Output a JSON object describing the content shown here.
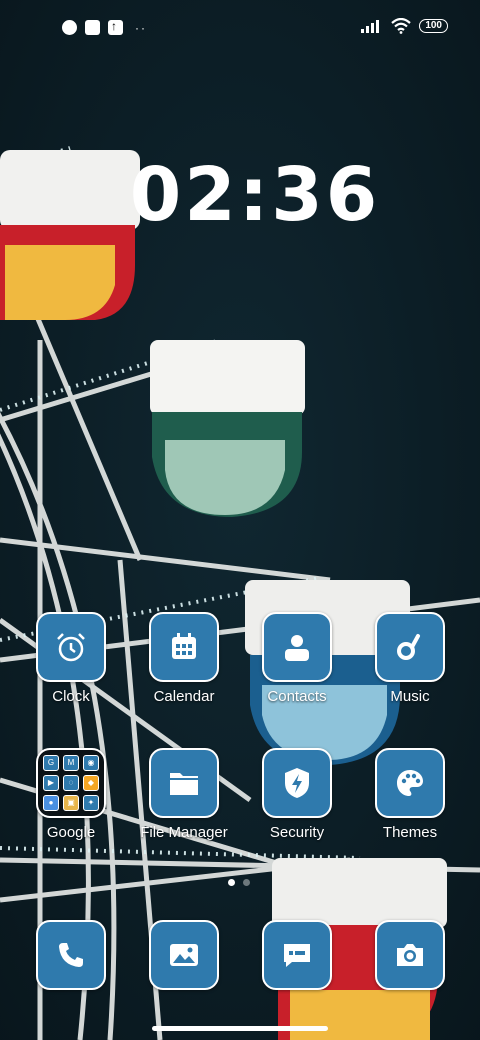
{
  "status_bar": {
    "battery": "100",
    "icons": [
      "status-app-icon",
      "square-icon",
      "upload-icon",
      "more-dots-icon",
      "signal-icon",
      "wifi-icon",
      "battery-icon"
    ],
    "more": "··"
  },
  "clock": "02:36",
  "apps_row1": [
    {
      "label": "Clock",
      "icon": "alarm-clock-icon"
    },
    {
      "label": "Calendar",
      "icon": "calendar-icon"
    },
    {
      "label": "Contacts",
      "icon": "contact-person-icon"
    },
    {
      "label": "Music",
      "icon": "music-note-icon"
    }
  ],
  "apps_row2": [
    {
      "label": "Google",
      "icon": "folder-icon"
    },
    {
      "label": "File Manager",
      "icon": "folder-icon"
    },
    {
      "label": "Security",
      "icon": "shield-bolt-icon"
    },
    {
      "label": "Themes",
      "icon": "palette-icon"
    }
  ],
  "google_folder": {
    "minis": [
      "G",
      "M",
      "◉",
      "▶",
      "◌",
      "◆",
      "●",
      "▣",
      "✦"
    ]
  },
  "dock": [
    {
      "icon": "phone-icon"
    },
    {
      "icon": "gallery-icon"
    },
    {
      "icon": "messages-icon"
    },
    {
      "icon": "camera-icon"
    }
  ],
  "page_indicator": {
    "pages": 2,
    "current": 1
  },
  "colors": {
    "tile": "#2f7aad",
    "tile_border": "#ffffff",
    "background": "#0c1b22"
  }
}
